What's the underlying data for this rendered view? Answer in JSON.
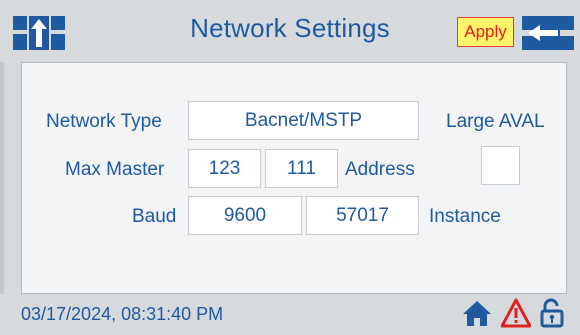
{
  "header": {
    "title": "Network Settings",
    "apply_label": "Apply",
    "icons": [
      "hierarchy-up-icon",
      "back-arrow-icon"
    ]
  },
  "form": {
    "network_type_label": "Network Type",
    "network_type_value": "Bacnet/MSTP",
    "large_aval_label": "Large AVAL",
    "large_aval_checked": false,
    "max_master_label": "Max Master",
    "max_master_value": "123",
    "address_value": "111",
    "address_label": "Address",
    "baud_label": "Baud",
    "baud_value": "9600",
    "instance_value": "57017",
    "instance_label": "Instance"
  },
  "footer": {
    "datetime": "03/17/2024, 08:31:40 PM",
    "icons": [
      "home-icon",
      "warning-icon",
      "unlock-icon"
    ]
  },
  "colors": {
    "accent": "#1f5aa0",
    "apply_bg": "#fff36a",
    "apply_text": "#e02020",
    "warning": "#e02020"
  }
}
